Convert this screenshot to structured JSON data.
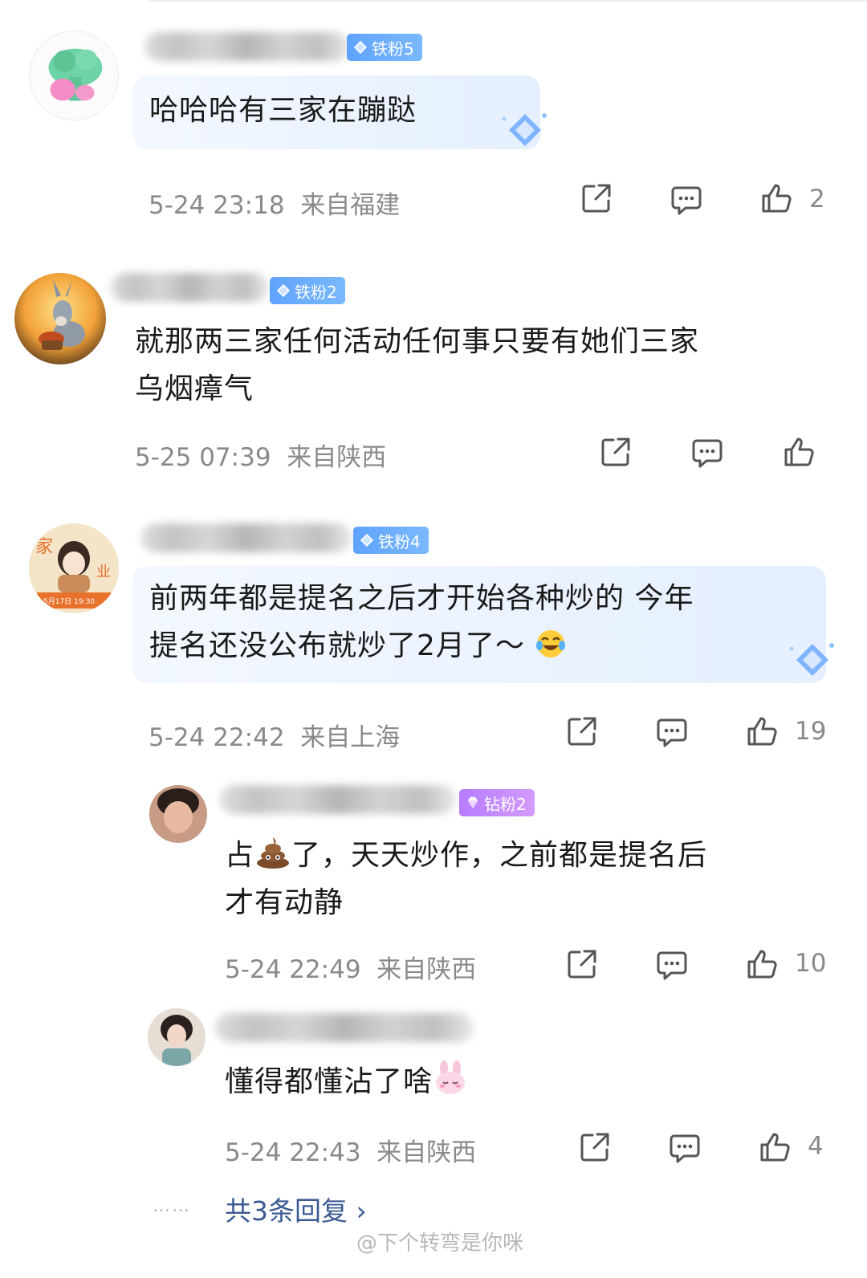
{
  "comments": [
    {
      "badge": "铁粉5",
      "text_lines": [
        "哈哈哈有三家在蹦跶"
      ],
      "date": "5-24 23:18",
      "location": "来自福建",
      "likes": "2"
    },
    {
      "badge": "铁粉2",
      "text_lines": [
        "就那两三家任何活动任何事只要有她们三家",
        "乌烟瘴气"
      ],
      "date": "5-25 07:39",
      "location": "来自陕西",
      "likes": ""
    },
    {
      "badge": "铁粉4",
      "avatar_text": "家",
      "avatar_text_2": "业",
      "avatar_caption": "5月17日 19:30",
      "text_lines": [
        "前两年都是提名之后才开始各种炒的 今年",
        "提名还没公布就炒了2月了～"
      ],
      "date": "5-24 22:42",
      "location": "来自上海",
      "likes": "19"
    }
  ],
  "replies": [
    {
      "badge": "钻粉2",
      "line1_before": "占",
      "line1_after": "了，天天炒作，之前都是提名后",
      "line2": "才有动静",
      "date": "5-24 22:49",
      "location": "来自陕西",
      "likes": "10"
    },
    {
      "text": "懂得都懂沾了啥",
      "date": "5-24 22:43",
      "location": "来自陕西",
      "likes": "4"
    }
  ],
  "more_replies": {
    "dots": "……",
    "label": "共3条回复 ›"
  },
  "watermark": "@下个转弯是你咪",
  "colors": {
    "badge_blue": "#5fa3ff",
    "badge_purple": "#b57cff",
    "link": "#3a5a93",
    "meta": "#8a8a8a"
  },
  "icons": [
    "share-icon",
    "comment-icon",
    "thumbs-up-icon",
    "diamond-icon",
    "laugh-cry-emoji",
    "poop-emoji",
    "bunny-emoji"
  ]
}
